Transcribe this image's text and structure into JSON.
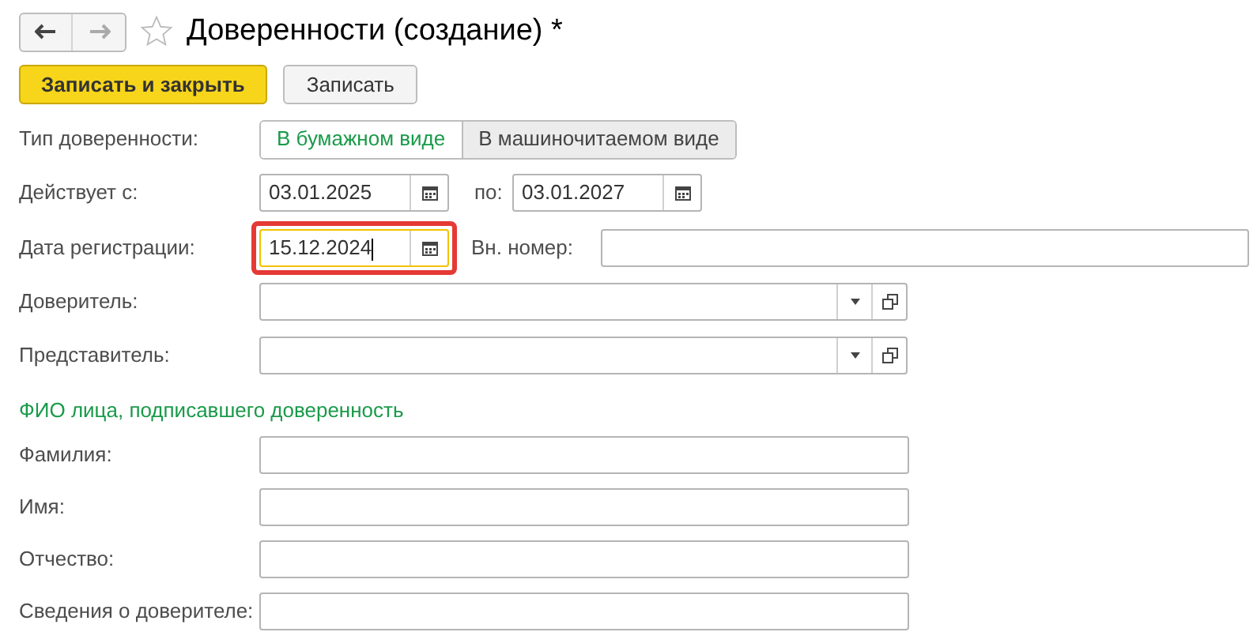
{
  "window": {
    "title": "Доверенности (создание) *",
    "favorite": false
  },
  "buttons": [
    {
      "label": "Записать и закрыть",
      "kind": "primary"
    },
    {
      "label": "Записать",
      "kind": "default"
    }
  ],
  "type_field": {
    "label": "Тип доверенности:",
    "options": [
      {
        "label": "В бумажном виде",
        "selected": true
      },
      {
        "label": "В машиночитаемом виде",
        "selected": false
      }
    ]
  },
  "valid_from": {
    "label": "Действует с:",
    "value": "03.01.2025"
  },
  "valid_to": {
    "label": "по:",
    "value": "03.01.2027"
  },
  "registration_date": {
    "label": "Дата регистрации:",
    "value": "15.12.2024",
    "focused": true,
    "highlighted": true
  },
  "internal_number": {
    "label": "Вн. номер:"
  },
  "refs": [
    {
      "label": "Доверитель:"
    },
    {
      "label": "Представитель:"
    }
  ],
  "signer_section": {
    "title": "ФИО лица, подписавшего доверенность",
    "fields": [
      {
        "label": "Фамилия:"
      },
      {
        "label": "Имя:"
      },
      {
        "label": "Отчество:"
      },
      {
        "label": "Сведения о доверителе:"
      }
    ]
  }
}
